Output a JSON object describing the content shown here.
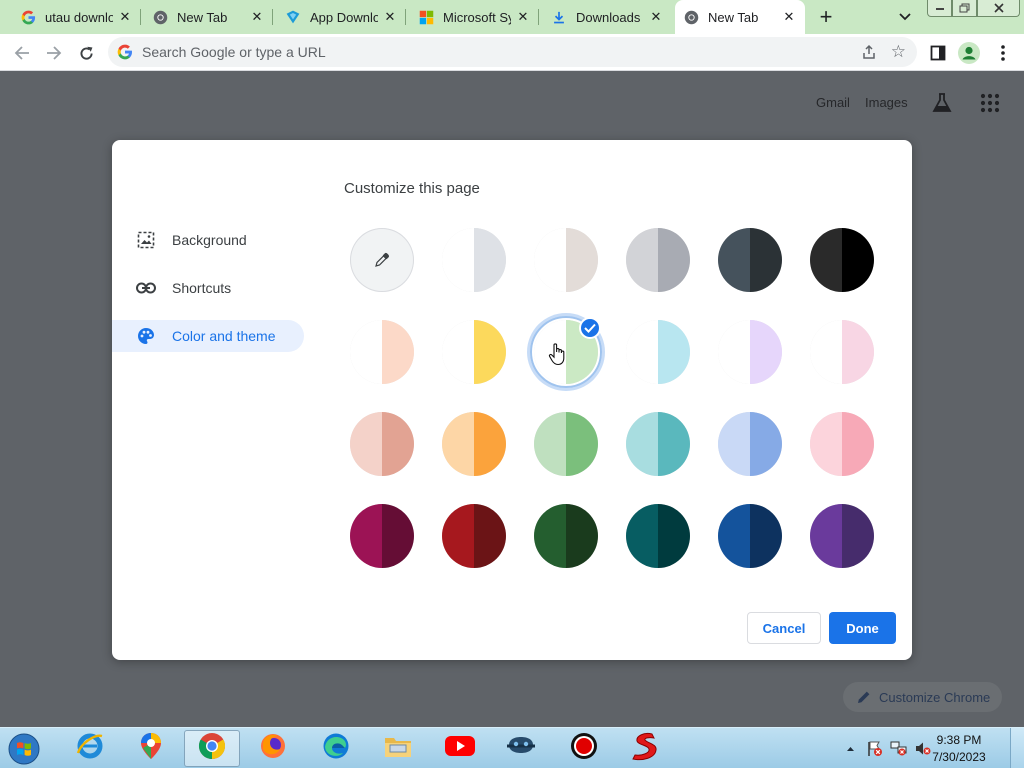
{
  "browser": {
    "tabs": [
      {
        "title": "utau downlo",
        "icon": "google-icon"
      },
      {
        "title": "New Tab",
        "icon": "chrome-icon"
      },
      {
        "title": "App Downlo",
        "icon": "app-download-icon"
      },
      {
        "title": "Microsoft Sy",
        "icon": "microsoft-icon"
      },
      {
        "title": "Downloads",
        "icon": "download-icon"
      },
      {
        "title": "New Tab",
        "icon": "chrome-icon",
        "active": true
      }
    ],
    "new_tab_label": "+",
    "omnibox": {
      "placeholder": "Search Google or type a URL",
      "value": ""
    },
    "colors": {
      "tab_strip": "#c9e8c4",
      "accent": "#1a73e8"
    }
  },
  "ntp": {
    "gmail": "Gmail",
    "images": "Images",
    "customize_chrome": "Customize Chrome"
  },
  "dialog": {
    "title": "Customize this page",
    "nav": [
      {
        "label": "Background",
        "icon": "image-icon"
      },
      {
        "label": "Shortcuts",
        "icon": "link-icon"
      },
      {
        "label": "Color and theme",
        "icon": "palette-icon",
        "active": true
      }
    ],
    "themes": [
      [
        {
          "name": "custom",
          "left": "#f1f3f4",
          "right": "#f1f3f4",
          "icon": "eyedropper-icon"
        },
        {
          "name": "default-light",
          "left": "#ffffff",
          "right": "#dee1e6"
        },
        {
          "name": "warm-grey",
          "left": "#ffffff",
          "right": "#e3dcd8"
        },
        {
          "name": "cool-grey",
          "left": "#d2d3d7",
          "right": "#a8abb3"
        },
        {
          "name": "slate",
          "left": "#45525c",
          "right": "#2b3236"
        },
        {
          "name": "black",
          "left": "#2a2a2a",
          "right": "#000000"
        }
      ],
      [
        {
          "name": "peach-light",
          "left": "#ffffff",
          "right": "#fcd9c8"
        },
        {
          "name": "yellow-light",
          "left": "#ffffff",
          "right": "#fcd95c"
        },
        {
          "name": "green-light",
          "left": "#ffffff",
          "right": "#cbe9c4",
          "selected": true
        },
        {
          "name": "cyan-light",
          "left": "#ffffff",
          "right": "#b8e6f0"
        },
        {
          "name": "lavender-light",
          "left": "#ffffff",
          "right": "#e6d6fb"
        },
        {
          "name": "pink-light",
          "left": "#ffffff",
          "right": "#f8d6e4"
        }
      ],
      [
        {
          "name": "apricot",
          "left": "#f4d2c9",
          "right": "#e2a393"
        },
        {
          "name": "orange",
          "left": "#fdd6a6",
          "right": "#fba33c"
        },
        {
          "name": "green",
          "left": "#bfe0bf",
          "right": "#7bbf7c"
        },
        {
          "name": "teal",
          "left": "#a8dde0",
          "right": "#5ab8bd"
        },
        {
          "name": "blue",
          "left": "#c9d9f6",
          "right": "#86aae6"
        },
        {
          "name": "rose",
          "left": "#fcd4dc",
          "right": "#f7a9b7"
        }
      ],
      [
        {
          "name": "dark-magenta",
          "left": "#9c1355",
          "right": "#650d35"
        },
        {
          "name": "dark-red",
          "left": "#a6181e",
          "right": "#6b1416"
        },
        {
          "name": "dark-green",
          "left": "#245e2f",
          "right": "#1a3b1d"
        },
        {
          "name": "dark-teal",
          "left": "#075d62",
          "right": "#003b3e"
        },
        {
          "name": "dark-blue",
          "left": "#14539c",
          "right": "#0d325f"
        },
        {
          "name": "dark-violet",
          "left": "#6a3a9c",
          "right": "#462c6c"
        }
      ]
    ],
    "cancel": "Cancel",
    "done": "Done"
  },
  "taskbar": {
    "apps": [
      {
        "name": "internet-explorer-icon"
      },
      {
        "name": "maps-icon"
      },
      {
        "name": "chrome-icon",
        "active": true
      },
      {
        "name": "firefox-icon"
      },
      {
        "name": "edge-icon"
      },
      {
        "name": "file-explorer-icon"
      },
      {
        "name": "youtube-icon"
      },
      {
        "name": "game-icon"
      },
      {
        "name": "record-icon"
      },
      {
        "name": "speed-icon"
      }
    ],
    "time": "9:38 PM",
    "date": "7/30/2023"
  }
}
